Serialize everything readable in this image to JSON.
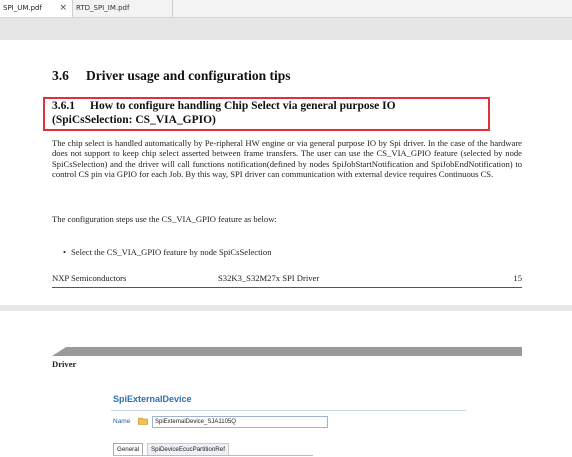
{
  "tabs": [
    {
      "label": "SPI_UM.pdf",
      "active": true,
      "close_glyph": "×"
    },
    {
      "label": "RTD_SPI_IM.pdf",
      "active": false
    }
  ],
  "page1": {
    "section_number": "3.6",
    "section_title": "Driver usage and configuration tips",
    "subsection_number": "3.6.1",
    "subsection_title_line1": "How to configure handling Chip Select via general purpose IO",
    "subsection_title_line2": "(SpiCsSelection: CS_VIA_GPIO)",
    "paragraph1": "The chip select is handled automatically by Pe-ripheral HW engine or via general purpose IO by Spi driver. In the case of the hardware does not support to keep chip select asserted between frame transfers. The user can use the CS_VIA_GPIO feature (selected by node SpiCsSelection) and the driver will call functions notification(defined by nodes SpiJobStartNotification and SpiJobEndNotification) to control CS pin via GPIO for each Job. By this way, SPI driver can communication with external device requires Continuous CS.",
    "paragraph2": "The configuration steps use the CS_VIA_GPIO feature as below:",
    "bullet_glyph": "•",
    "bullet1": "Select the CS_VIA_GPIO feature by node SpiCsSelection",
    "footer_left": "NXP Semiconductors",
    "footer_center": "S32K3_S32M27x SPI Driver",
    "footer_page": "15",
    "highlight_color": "#e0303a"
  },
  "page2": {
    "header_label": "Driver",
    "config_title": "SpiExternalDevice",
    "name_label": "Name",
    "name_value": "SpiExternalDevice_SJA1105Q",
    "subtabs": [
      "General",
      "SpiDeviceEcucPartitionRef"
    ]
  },
  "icons": {
    "folder": "folder-icon",
    "close": "close-icon"
  }
}
